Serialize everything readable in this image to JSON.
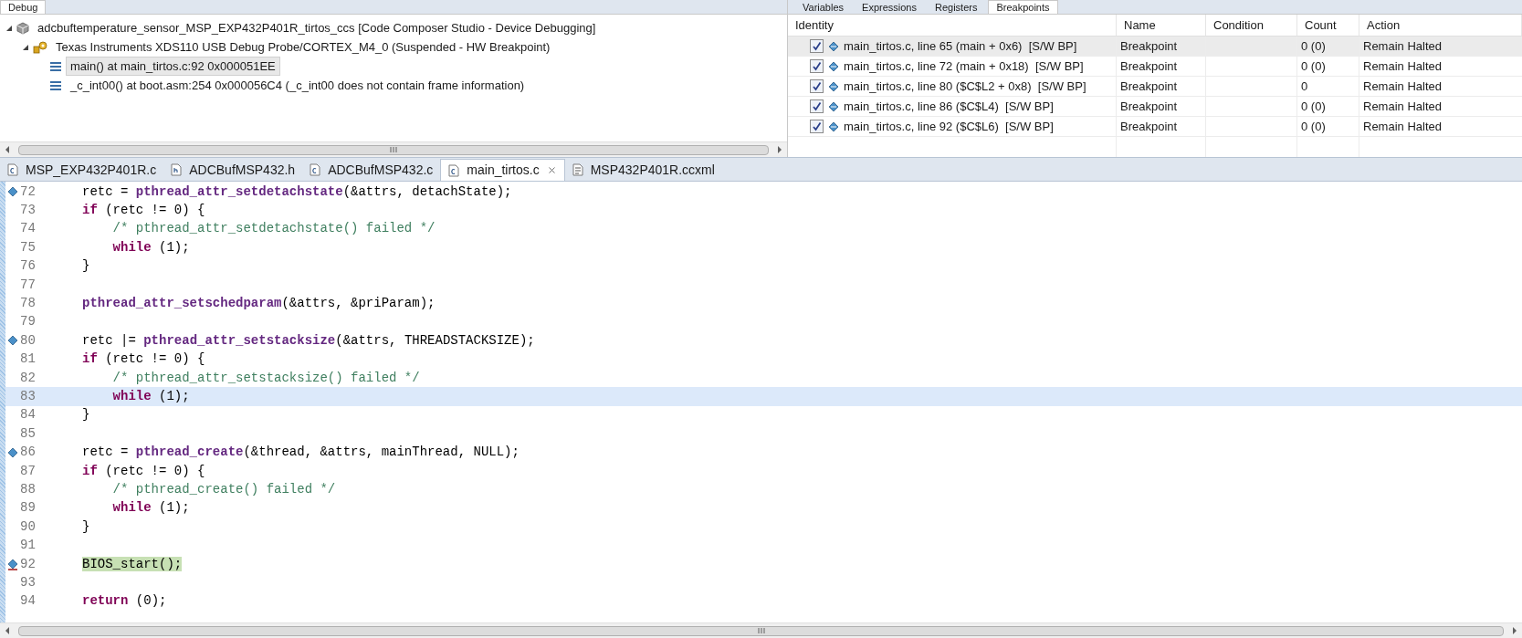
{
  "debug_view": {
    "tab": {
      "label": "Debug",
      "selected": true
    },
    "tree": [
      {
        "label": "adcbuftemperature_sensor_MSP_EXP432P401R_tirtos_ccs [Code Composer Studio - Device Debugging]",
        "kind": "project",
        "expanded": true,
        "selected": false,
        "children": [
          {
            "label": "Texas Instruments XDS110 USB Debug Probe/CORTEX_M4_0 (Suspended - HW Breakpoint)",
            "kind": "probe",
            "expanded": true,
            "selected": false,
            "children": [
              {
                "label": "main() at main_tirtos.c:92 0x000051EE",
                "kind": "frame",
                "selected": true
              },
              {
                "label": "_c_int00() at boot.asm:254 0x000056C4  (_c_int00 does not contain frame information)",
                "kind": "frame",
                "selected": false
              }
            ]
          }
        ]
      }
    ]
  },
  "breakpoints_view": {
    "tabs": [
      {
        "label": "Variables",
        "selected": false
      },
      {
        "label": "Expressions",
        "selected": false
      },
      {
        "label": "Registers",
        "selected": false
      },
      {
        "label": "Breakpoints",
        "selected": true
      }
    ],
    "columns": [
      "Identity",
      "Name",
      "Condition",
      "Count",
      "Action"
    ],
    "rows": [
      {
        "checked": true,
        "selected": true,
        "identity": "main_tirtos.c, line 65 (main + 0x6)  [S/W BP]",
        "name": "Breakpoint",
        "count": "0 (0)",
        "action": "Remain Halted"
      },
      {
        "checked": true,
        "selected": false,
        "identity": "main_tirtos.c, line 72 (main + 0x18)  [S/W BP]",
        "name": "Breakpoint",
        "count": "0 (0)",
        "action": "Remain Halted"
      },
      {
        "checked": true,
        "selected": false,
        "identity": "main_tirtos.c, line 80 ($C$L2 + 0x8)  [S/W BP]",
        "name": "Breakpoint",
        "count": "0",
        "action": "Remain Halted"
      },
      {
        "checked": true,
        "selected": false,
        "identity": "main_tirtos.c, line 86 ($C$L4)  [S/W BP]",
        "name": "Breakpoint",
        "count": "0 (0)",
        "action": "Remain Halted"
      },
      {
        "checked": true,
        "selected": false,
        "identity": "main_tirtos.c, line 92 ($C$L6)  [S/W BP]",
        "name": "Breakpoint",
        "count": "0 (0)",
        "action": "Remain Halted"
      }
    ]
  },
  "editor": {
    "tabs": [
      {
        "label": "MSP_EXP432P401R.c",
        "kind": "c",
        "selected": false
      },
      {
        "label": "ADCBufMSP432.h",
        "kind": "h",
        "selected": false
      },
      {
        "label": "ADCBufMSP432.c",
        "kind": "c",
        "selected": false
      },
      {
        "label": "main_tirtos.c",
        "kind": "c",
        "selected": true
      },
      {
        "label": "MSP432P401R.ccxml",
        "kind": "ccxml",
        "selected": false
      }
    ],
    "lines": [
      {
        "number": "72",
        "breakpoint": true,
        "pc": false,
        "current": false,
        "tokens": [
          {
            "kind": "plain",
            "text": "retc = "
          },
          {
            "kind": "func",
            "text": "pthread_attr_setdetachstate"
          },
          {
            "kind": "plain",
            "text": "(&attrs, detachState);"
          }
        ]
      },
      {
        "number": "73",
        "breakpoint": false,
        "pc": false,
        "current": false,
        "tokens": [
          {
            "kind": "keyword",
            "text": "if"
          },
          {
            "kind": "plain",
            "text": " (retc != 0) {"
          }
        ]
      },
      {
        "number": "74",
        "breakpoint": false,
        "pc": false,
        "current": false,
        "tokens": [
          {
            "kind": "comment",
            "text": "    /* pthread_attr_setdetachstate() failed */"
          }
        ]
      },
      {
        "number": "75",
        "breakpoint": false,
        "pc": false,
        "current": false,
        "tokens": [
          {
            "kind": "keyword",
            "text": "    while"
          },
          {
            "kind": "plain",
            "text": " (1);"
          }
        ]
      },
      {
        "number": "76",
        "breakpoint": false,
        "pc": false,
        "current": false,
        "tokens": [
          {
            "kind": "plain",
            "text": "}"
          }
        ]
      },
      {
        "number": "77",
        "breakpoint": false,
        "pc": false,
        "current": false
      },
      {
        "number": "78",
        "breakpoint": false,
        "pc": false,
        "current": false,
        "tokens": [
          {
            "kind": "func",
            "text": "pthread_attr_setschedparam"
          },
          {
            "kind": "plain",
            "text": "(&attrs, &priParam);"
          }
        ]
      },
      {
        "number": "79",
        "breakpoint": false,
        "pc": false,
        "current": false
      },
      {
        "number": "80",
        "breakpoint": true,
        "pc": false,
        "current": false,
        "tokens": [
          {
            "kind": "plain",
            "text": "retc |= "
          },
          {
            "kind": "func",
            "text": "pthread_attr_setstacksize"
          },
          {
            "kind": "plain",
            "text": "(&attrs, THREADSTACKSIZE);"
          }
        ]
      },
      {
        "number": "81",
        "breakpoint": false,
        "pc": false,
        "current": false,
        "tokens": [
          {
            "kind": "keyword",
            "text": "if"
          },
          {
            "kind": "plain",
            "text": " (retc != 0) {"
          }
        ]
      },
      {
        "number": "82",
        "breakpoint": false,
        "pc": false,
        "current": false,
        "tokens": [
          {
            "kind": "comment",
            "text": "    /* pthread_attr_setstacksize() failed */"
          }
        ]
      },
      {
        "number": "83",
        "breakpoint": false,
        "pc": false,
        "current": true,
        "tokens": [
          {
            "kind": "keyword",
            "text": "    while"
          },
          {
            "kind": "plain",
            "text": " (1);"
          }
        ]
      },
      {
        "number": "84",
        "breakpoint": false,
        "pc": false,
        "current": false,
        "tokens": [
          {
            "kind": "plain",
            "text": "}"
          }
        ]
      },
      {
        "number": "85",
        "breakpoint": false,
        "pc": false,
        "current": false
      },
      {
        "number": "86",
        "breakpoint": true,
        "pc": false,
        "current": false,
        "tokens": [
          {
            "kind": "plain",
            "text": "retc = "
          },
          {
            "kind": "func",
            "text": "pthread_create"
          },
          {
            "kind": "plain",
            "text": "(&thread, &attrs, mainThread, NULL);"
          }
        ]
      },
      {
        "number": "87",
        "breakpoint": false,
        "pc": false,
        "current": false,
        "tokens": [
          {
            "kind": "keyword",
            "text": "if"
          },
          {
            "kind": "plain",
            "text": " (retc != 0) {"
          }
        ]
      },
      {
        "number": "88",
        "breakpoint": false,
        "pc": false,
        "current": false,
        "tokens": [
          {
            "kind": "comment",
            "text": "    /* pthread_create() failed */"
          }
        ]
      },
      {
        "number": "89",
        "breakpoint": false,
        "pc": false,
        "current": false,
        "tokens": [
          {
            "kind": "keyword",
            "text": "    while"
          },
          {
            "kind": "plain",
            "text": " (1);"
          }
        ]
      },
      {
        "number": "90",
        "breakpoint": false,
        "pc": false,
        "current": false,
        "tokens": [
          {
            "kind": "plain",
            "text": "}"
          }
        ]
      },
      {
        "number": "91",
        "breakpoint": false,
        "pc": false,
        "current": false
      },
      {
        "number": "92",
        "breakpoint": true,
        "pc": true,
        "current": false,
        "tokens": [
          {
            "kind": "plain",
            "text": "BIOS_start();"
          }
        ]
      },
      {
        "number": "93",
        "breakpoint": false,
        "pc": false,
        "current": false
      },
      {
        "number": "94",
        "breakpoint": false,
        "pc": false,
        "current": false,
        "tokens": [
          {
            "kind": "keyword",
            "text": "return"
          },
          {
            "kind": "plain",
            "text": " (0);"
          }
        ]
      }
    ]
  }
}
